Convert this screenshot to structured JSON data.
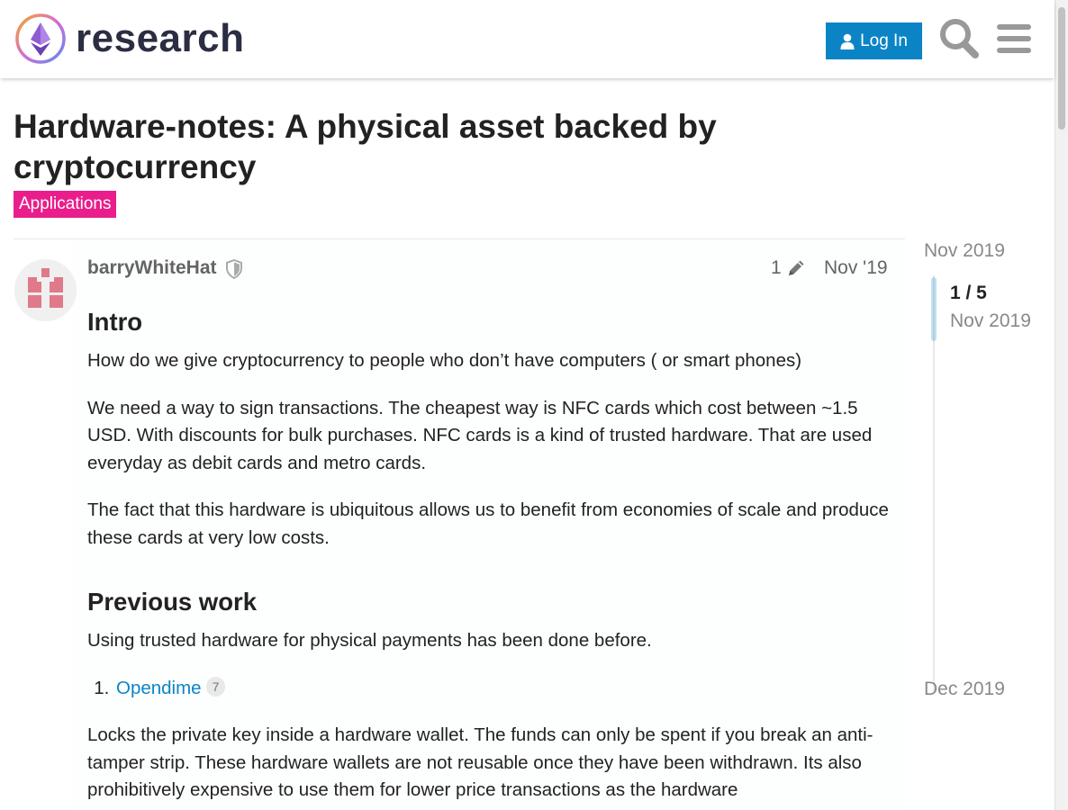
{
  "header": {
    "logo_text": "research",
    "login_label": "Log In",
    "icons": [
      "user-icon",
      "search-icon",
      "hamburger-menu-icon"
    ]
  },
  "topic": {
    "title": "Hardware-notes: A physical asset backed by cryptocurrency",
    "category": "Applications",
    "category_color": "#e91e8c"
  },
  "post": {
    "username": "barryWhiteHat",
    "edit_count": "1",
    "date": "Nov '19",
    "sections": {
      "intro_heading": "Intro",
      "intro_p1": "How do we give cryptocurrency to people who don’t have computers ( or smart phones)",
      "intro_p2": "We need a way to sign transactions. The cheapest way is NFC cards which cost between ~1.5 USD. With discounts for bulk purchases. NFC cards is a kind of trusted hardware. That are used everyday as debit cards and metro cards.",
      "intro_p3": "The fact that this hardware is ubiquitous allows us to benefit from economies of scale and produce these cards at very low costs.",
      "prev_heading": "Previous work",
      "prev_p1": "Using trusted hardware for physical payments has been done before.",
      "list": [
        {
          "link": "Opendime",
          "clicks": "7"
        }
      ],
      "prev_p2": "Locks the private key inside a hardware wallet. The funds can only be spent if you break an anti-tamper strip. These hardware wallets are not reusable once they have been withdrawn. Its also prohibitively expensive to use them for lower price transactions as the hardware"
    }
  },
  "timeline": {
    "start": "Nov 2019",
    "position": "1 / 5",
    "position_date": "Nov 2019",
    "end": "Dec 2019"
  },
  "colors": {
    "accent": "#0b84c6",
    "category": "#e91e8c"
  }
}
